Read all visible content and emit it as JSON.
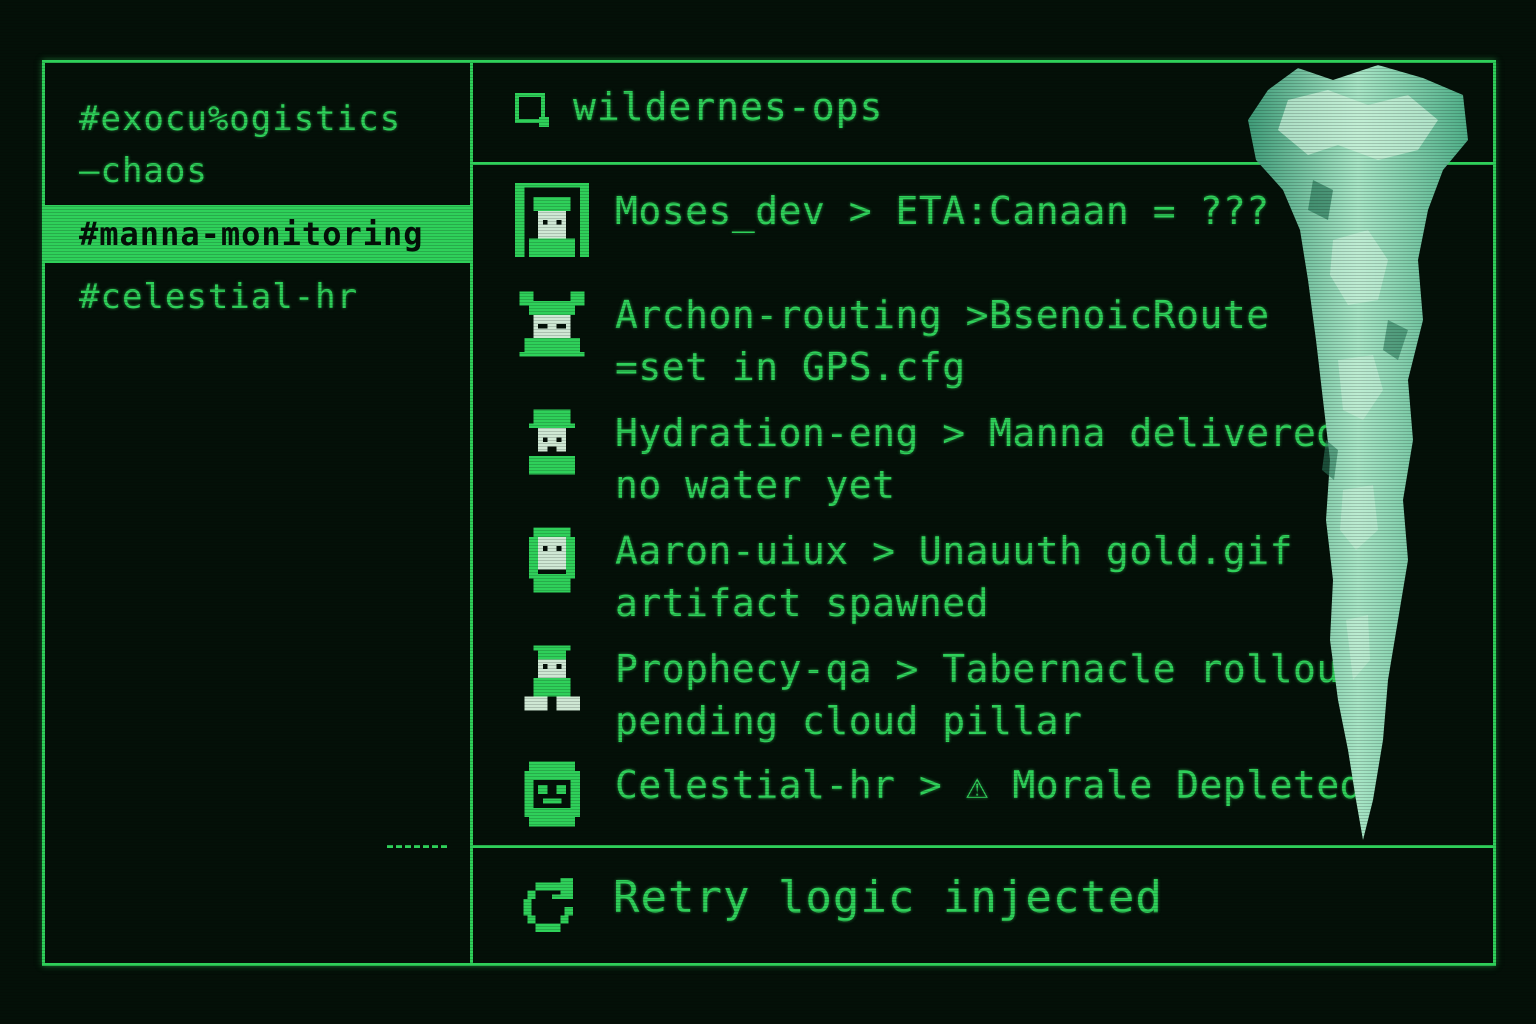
{
  "sidebar": {
    "channels": [
      {
        "label": "#exocu%ogistics\n—chaos",
        "active": false
      },
      {
        "label": "#manna-monitoring",
        "active": true
      },
      {
        "label": "#celestial-hr",
        "active": false
      }
    ]
  },
  "header": {
    "title": "wildernes-ops",
    "icon": "window-icon"
  },
  "messages": [
    {
      "text": "Moses_dev > ETA:Canaan = ???",
      "avatar": "moses-avatar"
    },
    {
      "text": "Archon-routing >BsenoicRoute\n=set in GPS.cfg",
      "avatar": "archon-avatar"
    },
    {
      "text": "Hydration-eng > Manna delivered\nno water yet",
      "avatar": "hydration-avatar"
    },
    {
      "text": "Aaron-uiux > Unauuth gold.gif\nartifact spawned",
      "avatar": "aaron-avatar"
    },
    {
      "text": "Prophecy-qa > Tabernacle rollout\npending cloud pillar",
      "avatar": "prophecy-avatar"
    },
    {
      "text": "Celestial-hr > ⚠ Morale Depleted",
      "avatar": "celestial-avatar"
    }
  ],
  "footer": {
    "status": "Retry logic injected",
    "icon": "refresh-icon"
  },
  "colors": {
    "phosphor": "#2fd05a",
    "background": "#041008",
    "cloud": "#9fe0c0"
  }
}
